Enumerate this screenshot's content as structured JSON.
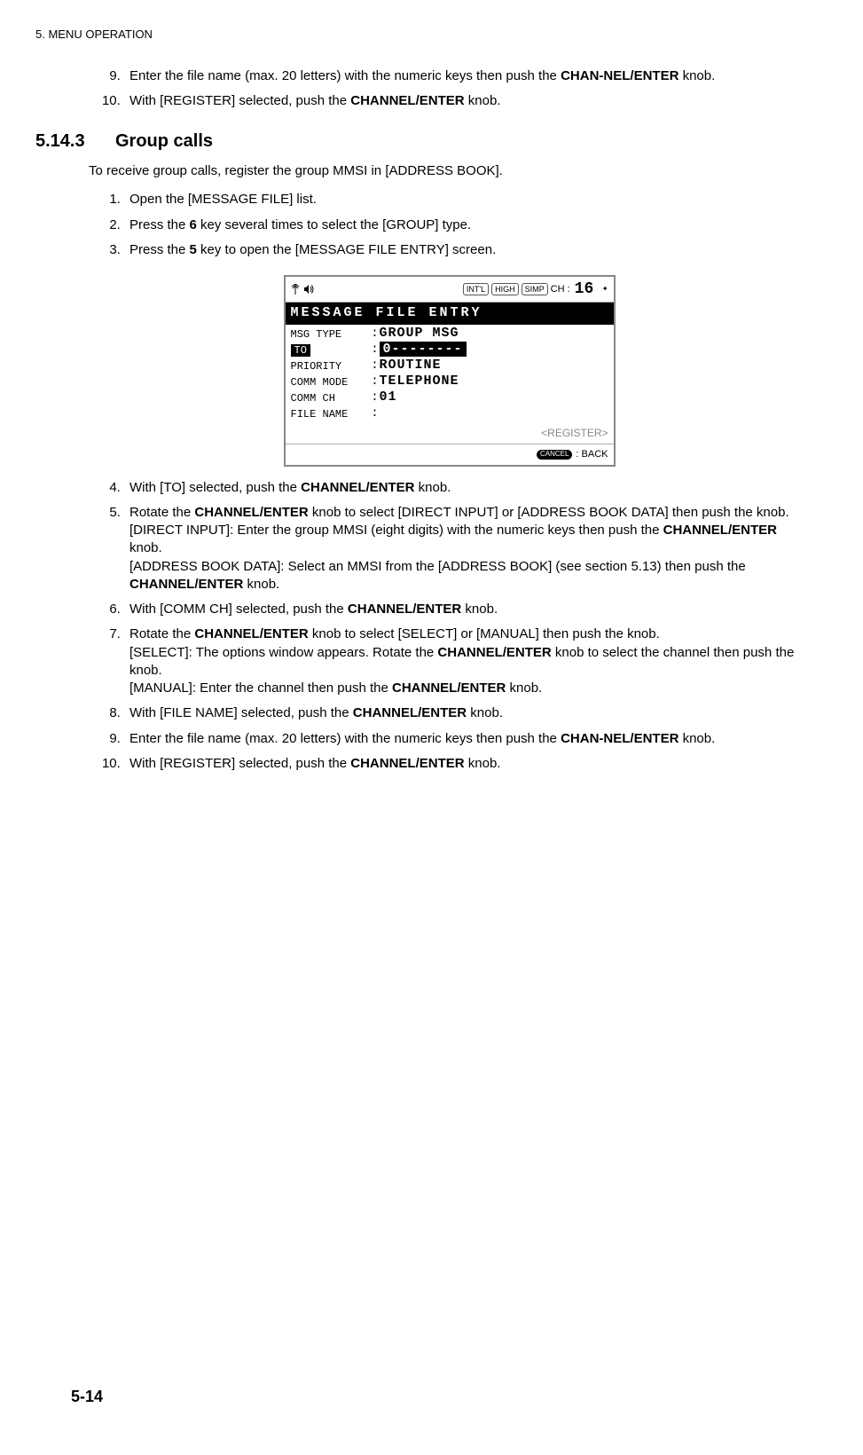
{
  "header": {
    "chapter": "5.  MENU OPERATION"
  },
  "pre_steps": [
    {
      "n": "9.",
      "html": "Enter the file name (max. 20 letters) with the numeric keys then push the <b>CHAN-NEL/ENTER</b> knob."
    },
    {
      "n": "10.",
      "html": "With [REGISTER] selected, push the <b>CHANNEL/ENTER</b> knob."
    }
  ],
  "section": {
    "number": "5.14.3",
    "title": "Group calls"
  },
  "intro": "To receive group calls, register the group MMSI in [ADDRESS BOOK].",
  "steps_a": [
    {
      "n": "1.",
      "html": "Open the [MESSAGE FILE] list."
    },
    {
      "n": "2.",
      "html": "Press the <b>6</b> key several times to select the [GROUP] type."
    },
    {
      "n": "3.",
      "html": "Press the <b>5</b> key to open the [MESSAGE FILE ENTRY] screen."
    }
  ],
  "screenshot": {
    "pills": [
      "INT'L",
      "HIGH",
      "SIMP"
    ],
    "ch_label": "CH :",
    "ch_num": "16",
    "title": "MESSAGE FILE ENTRY",
    "rows": [
      {
        "label": "MSG TYPE",
        "value": "GROUP MSG",
        "selected": false
      },
      {
        "label": "TO",
        "value": "0--------",
        "selected": true
      },
      {
        "label": "PRIORITY",
        "value": "ROUTINE",
        "selected": false
      },
      {
        "label": "COMM MODE",
        "value": "TELEPHONE",
        "selected": false
      },
      {
        "label": "COMM CH",
        "value": "01",
        "selected": false
      },
      {
        "label": "FILE NAME",
        "value": "",
        "selected": false
      }
    ],
    "register": "<REGISTER>",
    "cancel": "CANCEL",
    "back": ": BACK"
  },
  "steps_b": [
    {
      "n": "4.",
      "html": "With [TO] selected, push the <b>CHANNEL/ENTER</b> knob."
    },
    {
      "n": "5.",
      "html": "Rotate the <b>CHANNEL/ENTER</b> knob to select [DIRECT INPUT] or [ADDRESS BOOK DATA] then push the knob.<br>[DIRECT INPUT]: Enter the group MMSI (eight digits) with the numeric keys then push the <b>CHANNEL/ENTER</b> knob.<br>[ADDRESS BOOK DATA]: Select an MMSI from the [ADDRESS BOOK] (see section 5.13) then push the <b>CHANNEL/ENTER</b> knob."
    },
    {
      "n": "6.",
      "html": "With [COMM CH] selected, push the <b>CHANNEL/ENTER</b> knob."
    },
    {
      "n": "7.",
      "html": "Rotate the <b>CHANNEL/ENTER</b> knob to select [SELECT] or [MANUAL] then push the knob.<br>[SELECT]: The options window appears. Rotate the <b>CHANNEL/ENTER</b> knob to select the channel then push the knob.<br>[MANUAL]: Enter the channel then push the <b>CHANNEL/ENTER</b> knob."
    },
    {
      "n": "8.",
      "html": "With [FILE NAME] selected, push the <b>CHANNEL/ENTER</b> knob."
    },
    {
      "n": "9.",
      "html": "Enter the file name (max. 20 letters) with the numeric keys then push the <b>CHAN-NEL/ENTER</b> knob."
    },
    {
      "n": "10.",
      "html": "With [REGISTER] selected, push the <b>CHANNEL/ENTER</b> knob."
    }
  ],
  "page_number": "5-14"
}
